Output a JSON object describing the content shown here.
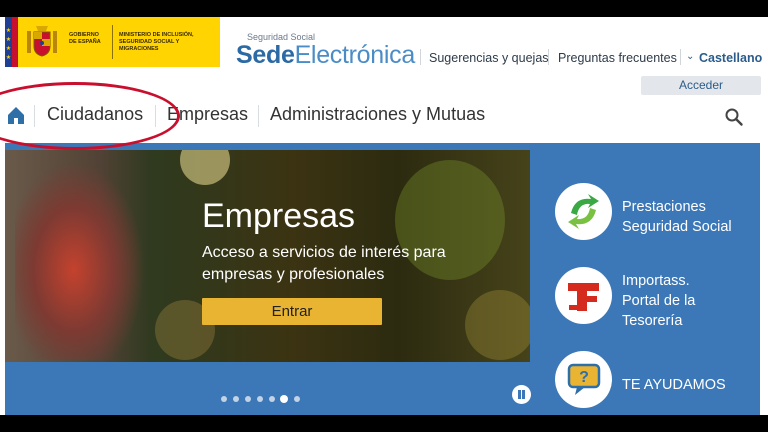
{
  "header": {
    "gov_text": "GOBIERNO DE ESPAÑA",
    "ministry_text": "MINISTERIO DE INCLUSIÓN, SEGURIDAD SOCIAL Y MIGRACIONES",
    "sede_small": "Seguridad Social",
    "sede_bold": "Sede",
    "sede_light": "Electrónica",
    "links": [
      "Sugerencias y quejas",
      "Preguntas frecuentes"
    ],
    "language": "Castellano",
    "login_label": "Acceder"
  },
  "nav": {
    "items": [
      "Ciudadanos",
      "Empresas",
      "Administraciones y Mutuas"
    ]
  },
  "hero": {
    "title": "Empresas",
    "subtitle": "Acceso a servicios de interés para empresas y profesionales",
    "button_label": "Entrar",
    "slide_count": 7,
    "active_slide": 6
  },
  "services": [
    {
      "label_lines": [
        "Prestaciones",
        "Seguridad Social"
      ],
      "icon": "prestaciones-icon"
    },
    {
      "label_lines": [
        "Importass.",
        "Portal de la",
        "Tesorería"
      ],
      "icon": "importass-icon"
    },
    {
      "label_lines": [
        "TE AYUDAMOS"
      ],
      "icon": "help-chat-icon"
    }
  ],
  "colors": {
    "accent_blue": "#3c78b7",
    "button_yellow": "#e8b432",
    "logo_yellow": "#ffd400",
    "highlight_red": "#c8102e"
  }
}
